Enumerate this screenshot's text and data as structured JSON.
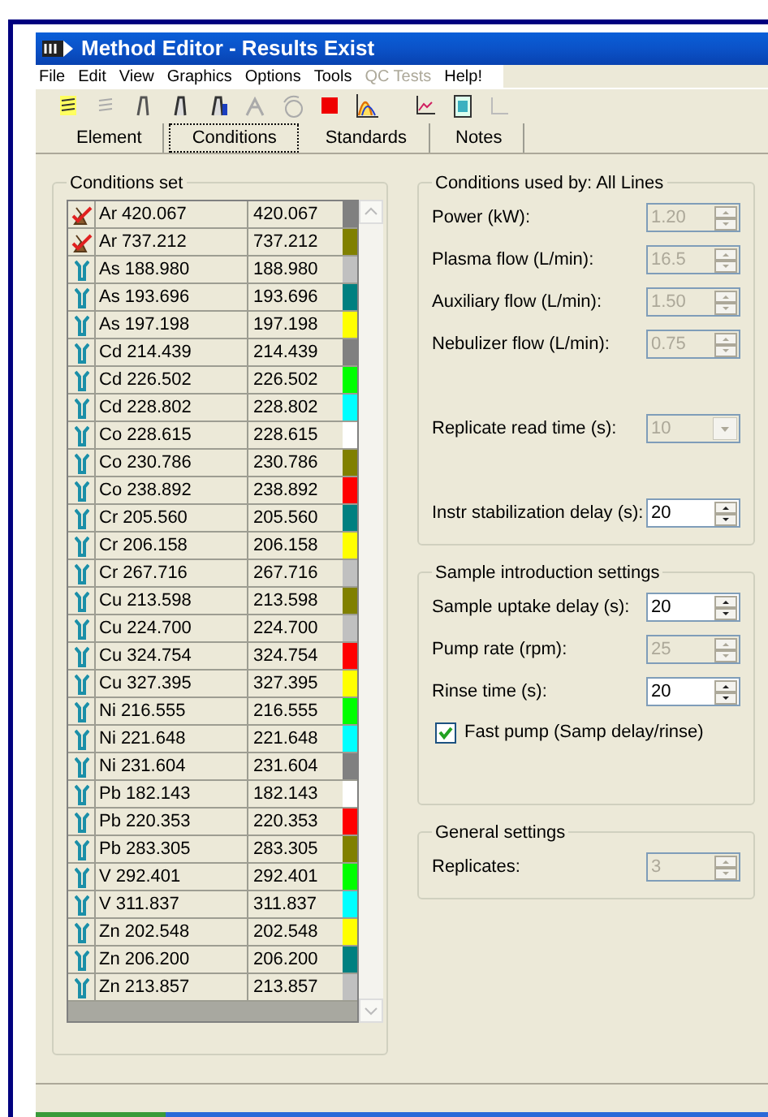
{
  "window": {
    "title": "Method Editor - Results Exist"
  },
  "menu": [
    {
      "label": "File",
      "disabled": false
    },
    {
      "label": "Edit",
      "disabled": false
    },
    {
      "label": "View",
      "disabled": false
    },
    {
      "label": "Graphics",
      "disabled": false
    },
    {
      "label": "Options",
      "disabled": false
    },
    {
      "label": "Tools",
      "disabled": false
    },
    {
      "label": "QC Tests",
      "disabled": true
    },
    {
      "label": "Help!",
      "disabled": false
    }
  ],
  "tabs": [
    {
      "label": "Element",
      "selected": false
    },
    {
      "label": "Conditions",
      "selected": true
    },
    {
      "label": "Standards",
      "selected": false
    },
    {
      "label": "Notes",
      "selected": false
    }
  ],
  "conditions_set": {
    "title": "Conditions set",
    "rows": [
      {
        "kind": "gas",
        "name": "Ar 420.067",
        "value": "420.067",
        "color": "#808080"
      },
      {
        "kind": "gas",
        "name": "Ar 737.212",
        "value": "737.212",
        "color": "#808000"
      },
      {
        "kind": "tube",
        "name": "As 188.980",
        "value": "188.980",
        "color": "#c0c0c0"
      },
      {
        "kind": "tube",
        "name": "As 193.696",
        "value": "193.696",
        "color": "#008080"
      },
      {
        "kind": "tube",
        "name": "As 197.198",
        "value": "197.198",
        "color": "#ffff00"
      },
      {
        "kind": "tube",
        "name": "Cd 214.439",
        "value": "214.439",
        "color": "#808080"
      },
      {
        "kind": "tube",
        "name": "Cd 226.502",
        "value": "226.502",
        "color": "#00ff00"
      },
      {
        "kind": "tube",
        "name": "Cd 228.802",
        "value": "228.802",
        "color": "#00ffff"
      },
      {
        "kind": "tube",
        "name": "Co 228.615",
        "value": "228.615",
        "color": "#ffffff"
      },
      {
        "kind": "tube",
        "name": "Co 230.786",
        "value": "230.786",
        "color": "#808000"
      },
      {
        "kind": "tube",
        "name": "Co 238.892",
        "value": "238.892",
        "color": "#ff0000"
      },
      {
        "kind": "tube",
        "name": "Cr 205.560",
        "value": "205.560",
        "color": "#008080"
      },
      {
        "kind": "tube",
        "name": "Cr 206.158",
        "value": "206.158",
        "color": "#ffff00"
      },
      {
        "kind": "tube",
        "name": "Cr 267.716",
        "value": "267.716",
        "color": "#c0c0c0"
      },
      {
        "kind": "tube",
        "name": "Cu 213.598",
        "value": "213.598",
        "color": "#808000"
      },
      {
        "kind": "tube",
        "name": "Cu 224.700",
        "value": "224.700",
        "color": "#c0c0c0"
      },
      {
        "kind": "tube",
        "name": "Cu 324.754",
        "value": "324.754",
        "color": "#ff0000"
      },
      {
        "kind": "tube",
        "name": "Cu 327.395",
        "value": "327.395",
        "color": "#ffff00"
      },
      {
        "kind": "tube",
        "name": "Ni 216.555",
        "value": "216.555",
        "color": "#00ff00"
      },
      {
        "kind": "tube",
        "name": "Ni 221.648",
        "value": "221.648",
        "color": "#00ffff"
      },
      {
        "kind": "tube",
        "name": "Ni 231.604",
        "value": "231.604",
        "color": "#808080"
      },
      {
        "kind": "tube",
        "name": "Pb 182.143",
        "value": "182.143",
        "color": "#ffffff"
      },
      {
        "kind": "tube",
        "name": "Pb 220.353",
        "value": "220.353",
        "color": "#ff0000"
      },
      {
        "kind": "tube",
        "name": "Pb 283.305",
        "value": "283.305",
        "color": "#808000"
      },
      {
        "kind": "tube",
        "name": "V 292.401",
        "value": "292.401",
        "color": "#00ff00"
      },
      {
        "kind": "tube",
        "name": "V 311.837",
        "value": "311.837",
        "color": "#00ffff"
      },
      {
        "kind": "tube",
        "name": "Zn 202.548",
        "value": "202.548",
        "color": "#ffff00"
      },
      {
        "kind": "tube",
        "name": "Zn 206.200",
        "value": "206.200",
        "color": "#008080"
      },
      {
        "kind": "tube",
        "name": "Zn 213.857",
        "value": "213.857",
        "color": "#c0c0c0"
      }
    ]
  },
  "groups": [
    {
      "title": "Conditions used by: All Lines",
      "items": [
        {
          "kind": "spin",
          "label": "Power (kW):",
          "value": "1.20",
          "disabled": true
        },
        {
          "kind": "spin",
          "label": "Plasma flow (L/min):",
          "value": "16.5",
          "disabled": true
        },
        {
          "kind": "spin",
          "label": "Auxiliary flow (L/min):",
          "value": "1.50",
          "disabled": true
        },
        {
          "kind": "spin",
          "label": "Nebulizer flow (L/min):",
          "value": "0.75",
          "disabled": true
        },
        {
          "kind": "gap"
        },
        {
          "kind": "dropdown",
          "label": "Replicate read time (s):",
          "value": "10",
          "disabled": true
        },
        {
          "kind": "gap"
        },
        {
          "kind": "spin",
          "label": "Instr stabilization delay (s):",
          "value": "20",
          "disabled": false
        }
      ]
    },
    {
      "title": "Sample introduction settings",
      "items": [
        {
          "kind": "spin",
          "label": "Sample uptake delay (s):",
          "value": "20",
          "disabled": false
        },
        {
          "kind": "spin",
          "label": "Pump rate (rpm):",
          "value": "25",
          "disabled": true
        },
        {
          "kind": "spin",
          "label": "Rinse time (s):",
          "value": "20",
          "disabled": false
        },
        {
          "kind": "checkbox",
          "label": "Fast pump (Samp delay/rinse)",
          "checked": true
        },
        {
          "kind": "gap"
        }
      ]
    },
    {
      "title": "General settings",
      "items": [
        {
          "kind": "spin",
          "label": "Replicates:",
          "value": "3",
          "disabled": true
        }
      ]
    }
  ]
}
